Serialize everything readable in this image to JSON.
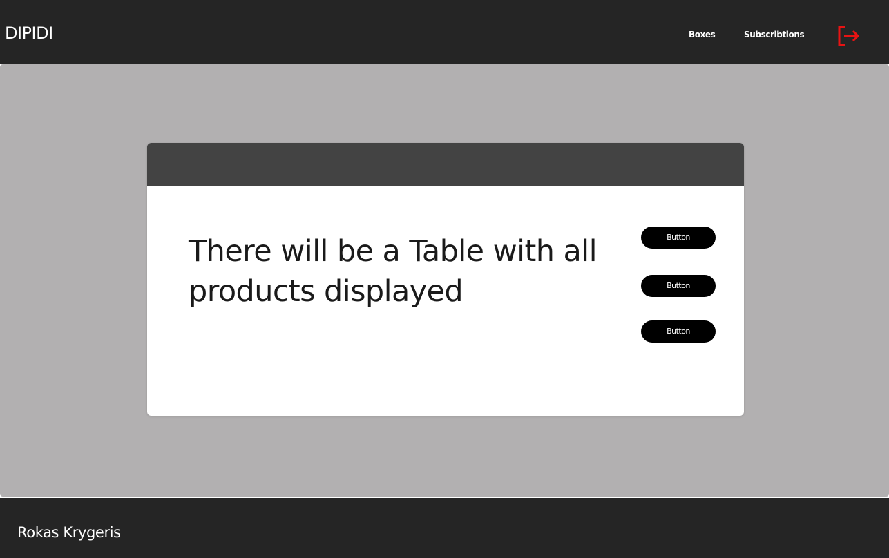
{
  "header": {
    "brand": "DIPIDI",
    "nav": [
      {
        "label": "Boxes"
      },
      {
        "label": "Subscribtions"
      }
    ],
    "logout_icon": "logout-icon",
    "logout_color": "#e81313"
  },
  "main": {
    "card": {
      "text": "There will be a Table with all products displayed",
      "buttons": [
        {
          "label": "Button"
        },
        {
          "label": "Button"
        },
        {
          "label": "Button"
        }
      ]
    }
  },
  "footer": {
    "name": "Rokas Krygeris"
  },
  "colors": {
    "header_bg": "#252525",
    "main_bg": "#b2b0b1",
    "card_header_bg": "#434343",
    "button_bg": "#000000"
  }
}
